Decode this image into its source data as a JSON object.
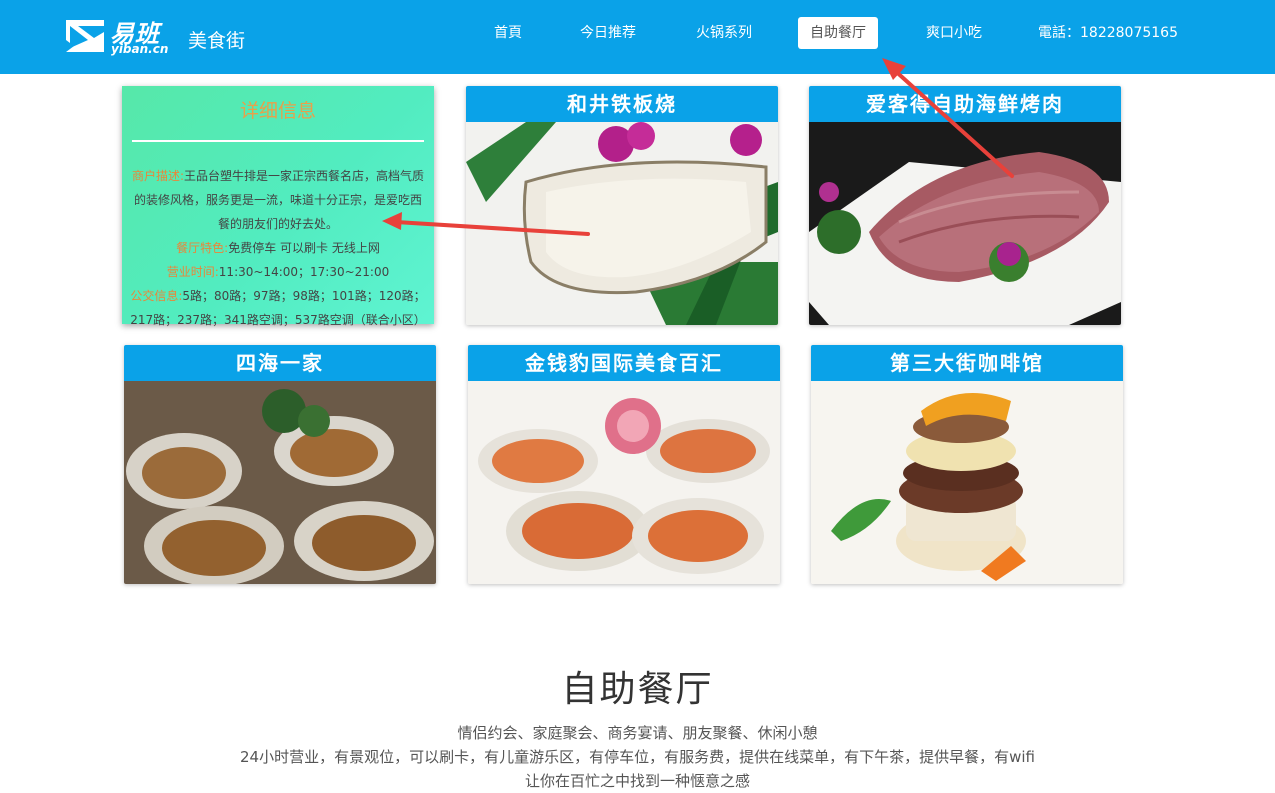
{
  "header": {
    "logo_text": "易班",
    "logo_sub": "yiban.cn",
    "site_name": "美食街",
    "nav": [
      {
        "label": "首頁"
      },
      {
        "label": "今日推荐"
      },
      {
        "label": "火锅系列"
      },
      {
        "label": "自助餐厅"
      },
      {
        "label": "爽口小吃"
      },
      {
        "label": "電話：18228075165"
      }
    ],
    "active_nav": "自助餐厅"
  },
  "detail_card": {
    "title": "详细信息",
    "desc_label": "商户描述:",
    "desc_text": "王品台塑牛排是一家正宗西餐名店，高档气质的装修风格，服务更是一流，味道十分正宗，是爱吃西餐的朋友们的好去处。",
    "feature_label": "餐厅特色:",
    "feature_text": "免费停车 可以刷卡 无线上网",
    "hours_label": "营业时间:",
    "hours_text": "11:30~14:00；17:30~21:00",
    "bus_label": "公交信息:",
    "bus_text": "5路；80路；97路；98路；101路；120路；217路；237路；341路空调；537路空调（联合小区）"
  },
  "cards": [
    {
      "title": "和井铁板烧",
      "image": "white-fish-fillet"
    },
    {
      "title": "爱客得自助海鲜烤肉",
      "image": "sliced-meat-platter"
    },
    {
      "title": "四海一家",
      "image": "grilled-oysters"
    },
    {
      "title": "金钱豹国际美食百汇",
      "image": "oysters-with-sauce"
    },
    {
      "title": "第三大街咖啡馆",
      "image": "gourmet-burger"
    }
  ],
  "section": {
    "title": "自助餐厅",
    "line1": "情侣约会、家庭聚会、商务宴请、朋友聚餐、休闲小憩",
    "line2": "24小时营业，有景观位，可以刷卡，有儿童游乐区，有停车位，有服务费，提供在线菜单，有下午茶，提供早餐，有wifi",
    "line3": "让你在百忙之中找到一种惬意之感"
  },
  "colors": {
    "brand": "#0aa2e8",
    "label_orange": "#e8863a",
    "arrow_red": "#e8413a"
  }
}
